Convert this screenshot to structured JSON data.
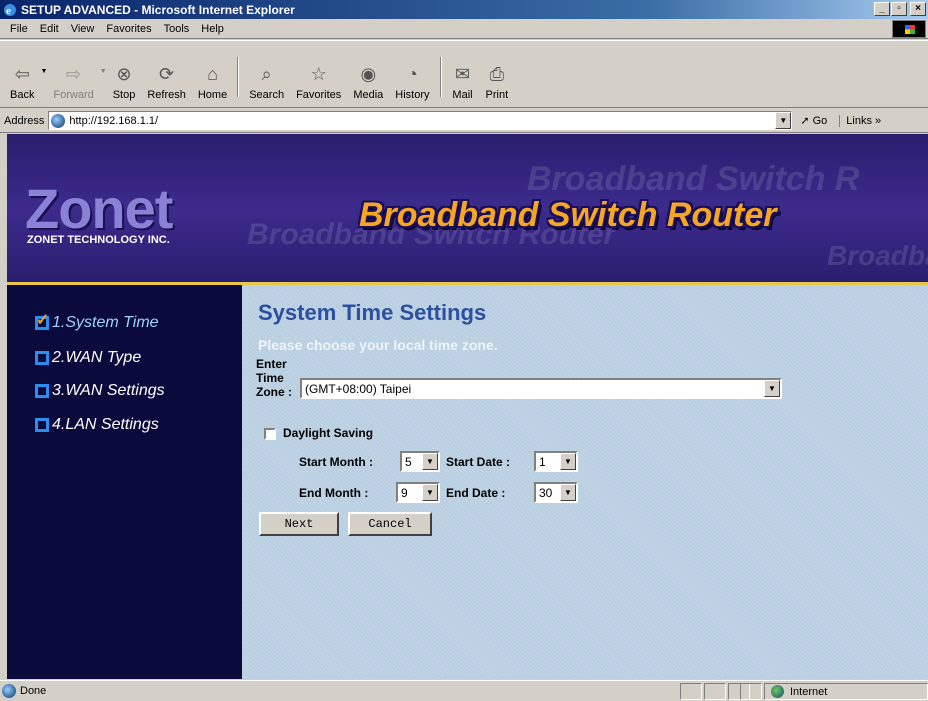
{
  "window": {
    "title": "SETUP ADVANCED - Microsoft Internet Explorer"
  },
  "menu": [
    "File",
    "Edit",
    "View",
    "Favorites",
    "Tools",
    "Help"
  ],
  "toolbar": {
    "back": "Back",
    "forward": "Forward",
    "stop": "Stop",
    "refresh": "Refresh",
    "home": "Home",
    "search": "Search",
    "favorites": "Favorites",
    "media": "Media",
    "history": "History",
    "mail": "Mail",
    "print": "Print"
  },
  "address": {
    "label": "Address",
    "url": "http://192.168.1.1/",
    "go": "Go",
    "links": "Links »"
  },
  "banner": {
    "logo": "Zonet",
    "company": "ZONET TECHNOLOGY INC.",
    "title": "Broadband Switch Router",
    "ghost_text": "Broadband Switch R"
  },
  "sidebar": {
    "items": [
      {
        "label": "1.System Time",
        "active": true
      },
      {
        "label": "2.WAN Type",
        "active": false
      },
      {
        "label": "3.WAN Settings",
        "active": false
      },
      {
        "label": "4.LAN Settings",
        "active": false
      }
    ]
  },
  "form": {
    "title": "System Time Settings",
    "subtitle": "Please choose your local time zone.",
    "tz_label_1": "Enter",
    "tz_label_2": "Time",
    "tz_label_3": "Zone :",
    "timezone": "(GMT+08:00) Taipei",
    "daylight_label": "Daylight Saving",
    "daylight_checked": false,
    "start_month_label": "Start Month :",
    "start_month": "5",
    "start_date_label": "Start Date :",
    "start_date": "1",
    "end_month_label": "End Month :",
    "end_month": "9",
    "end_date_label": "End Date :",
    "end_date": "30",
    "next": "Next",
    "cancel": "Cancel"
  },
  "status": {
    "text": "Done",
    "zone": "Internet"
  },
  "colors": {
    "banner_bg": "#2a1d6e",
    "sidebar_bg": "#0a0a3c",
    "title_blue": "#2c4fa0",
    "accent_orange": "#f5a623"
  }
}
